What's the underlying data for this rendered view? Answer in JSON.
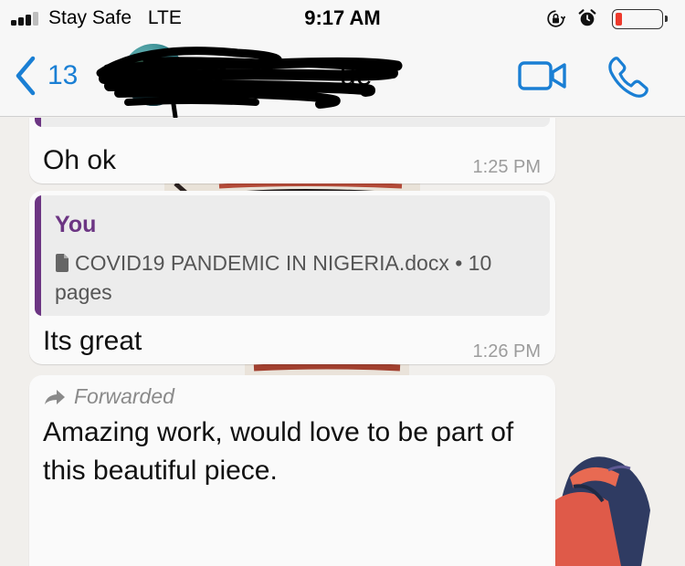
{
  "status_bar": {
    "carrier": "Stay Safe",
    "network": "LTE",
    "time": "9:17 AM",
    "signal_bars_filled": 3,
    "signal_bars_total": 4,
    "battery_level": 0.14,
    "icons": [
      "orientation-lock-icon",
      "alarm-icon",
      "battery-icon"
    ]
  },
  "header": {
    "back_count": "13",
    "contact_name_visible_fragment": "ue",
    "actions": [
      "video-call-icon",
      "phone-call-icon"
    ]
  },
  "messages": [
    {
      "text": "Oh ok",
      "time": "1:25 PM",
      "has_quote_above": true
    },
    {
      "quote": {
        "author": "You",
        "file_name": "COVID19 PANDEMIC IN NIGERIA.docx • 10 pages"
      },
      "text": "Its great",
      "time": "1:26 PM"
    },
    {
      "forwarded_label": "Forwarded",
      "text": "Amazing work,  would love to be part of this beautiful piece."
    }
  ],
  "colors": {
    "accent_blue": "#1a7fd4",
    "quote_purple": "#6c3583",
    "bubble_bg": "#fafafa",
    "chat_bg": "#f1efec",
    "battery_low": "#ee3a2c"
  }
}
